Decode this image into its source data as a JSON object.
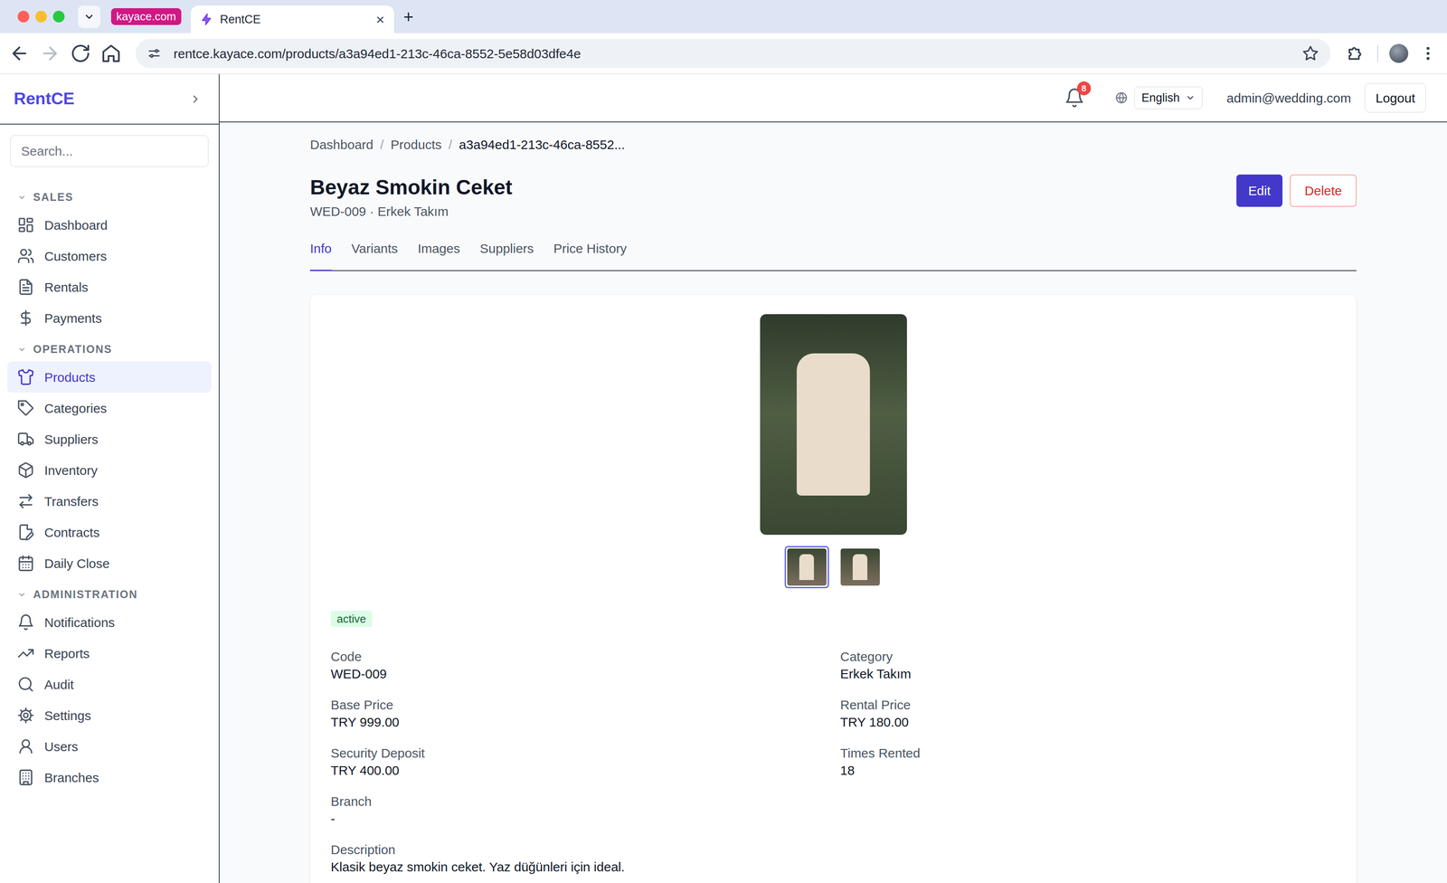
{
  "browser": {
    "tab_group": "kayace.com",
    "tabs": [
      {
        "label": "RentCE",
        "selected": true,
        "close": "×"
      }
    ],
    "new_tab": "+",
    "url": "rentce.kayace.com/products/a3a94ed1-213c-46ca-8552-5e58d03dfe4e"
  },
  "sidebar": {
    "logo": "RentCE",
    "search": {
      "placeholder": "Search..."
    },
    "sections": [
      {
        "title": "SALES",
        "expanded": true,
        "items": [
          {
            "label": "Dashboard",
            "selected": false
          },
          {
            "label": "Customers",
            "selected": false
          },
          {
            "label": "Rentals",
            "selected": false
          },
          {
            "label": "Payments",
            "selected": false
          }
        ]
      },
      {
        "title": "OPERATIONS",
        "expanded": true,
        "items": [
          {
            "label": "Products",
            "selected": true
          },
          {
            "label": "Categories",
            "selected": false
          },
          {
            "label": "Suppliers",
            "selected": false
          },
          {
            "label": "Inventory",
            "selected": false
          },
          {
            "label": "Transfers",
            "selected": false
          },
          {
            "label": "Contracts",
            "selected": false
          },
          {
            "label": "Daily Close",
            "selected": false
          }
        ]
      },
      {
        "title": "ADMINISTRATION",
        "expanded": true,
        "items": [
          {
            "label": "Notifications",
            "selected": false
          },
          {
            "label": "Reports",
            "selected": false
          },
          {
            "label": "Audit",
            "selected": false
          },
          {
            "label": "Settings",
            "selected": false
          },
          {
            "label": "Users",
            "selected": false
          },
          {
            "label": "Branches",
            "selected": false
          }
        ]
      }
    ]
  },
  "header": {
    "notifications": "8",
    "language": "English",
    "user": "admin@wedding.com",
    "logout": "Logout"
  },
  "breadcrumb": {
    "separator": "/",
    "items": [
      "Dashboard",
      "Products",
      "a3a94ed1-213c-46ca-8552..."
    ]
  },
  "product": {
    "title": "Beyaz Smokin Ceket",
    "subtitle": "WED-009 · Erkek Takım",
    "actions": {
      "edit": "Edit",
      "delete": "Delete"
    },
    "tabs": [
      {
        "label": "Info",
        "selected": true
      },
      {
        "label": "Variants",
        "selected": false
      },
      {
        "label": "Images",
        "selected": false
      },
      {
        "label": "Suppliers",
        "selected": false
      },
      {
        "label": "Price History",
        "selected": false
      }
    ],
    "thumbnails": [
      {
        "selected": true
      },
      {
        "selected": false
      }
    ],
    "status": "active",
    "fields": [
      {
        "label": "Code",
        "value": "WED-009",
        "kind": "half"
      },
      {
        "label": "Category",
        "value": "Erkek Takım",
        "kind": "half"
      },
      {
        "label": "Base Price",
        "value": "TRY 999.00",
        "kind": "half"
      },
      {
        "label": "Rental Price",
        "value": "TRY 180.00",
        "kind": "half"
      },
      {
        "label": "Security Deposit",
        "value": "TRY 400.00",
        "kind": "half"
      },
      {
        "label": "Times Rented",
        "value": "18",
        "kind": "half"
      },
      {
        "label": "Branch",
        "value": "-",
        "kind": "half"
      },
      {
        "label": "Description",
        "value": "Klasik beyaz smokin ceket. Yaz düğünleri için ideal.",
        "kind": "wide"
      }
    ]
  }
}
